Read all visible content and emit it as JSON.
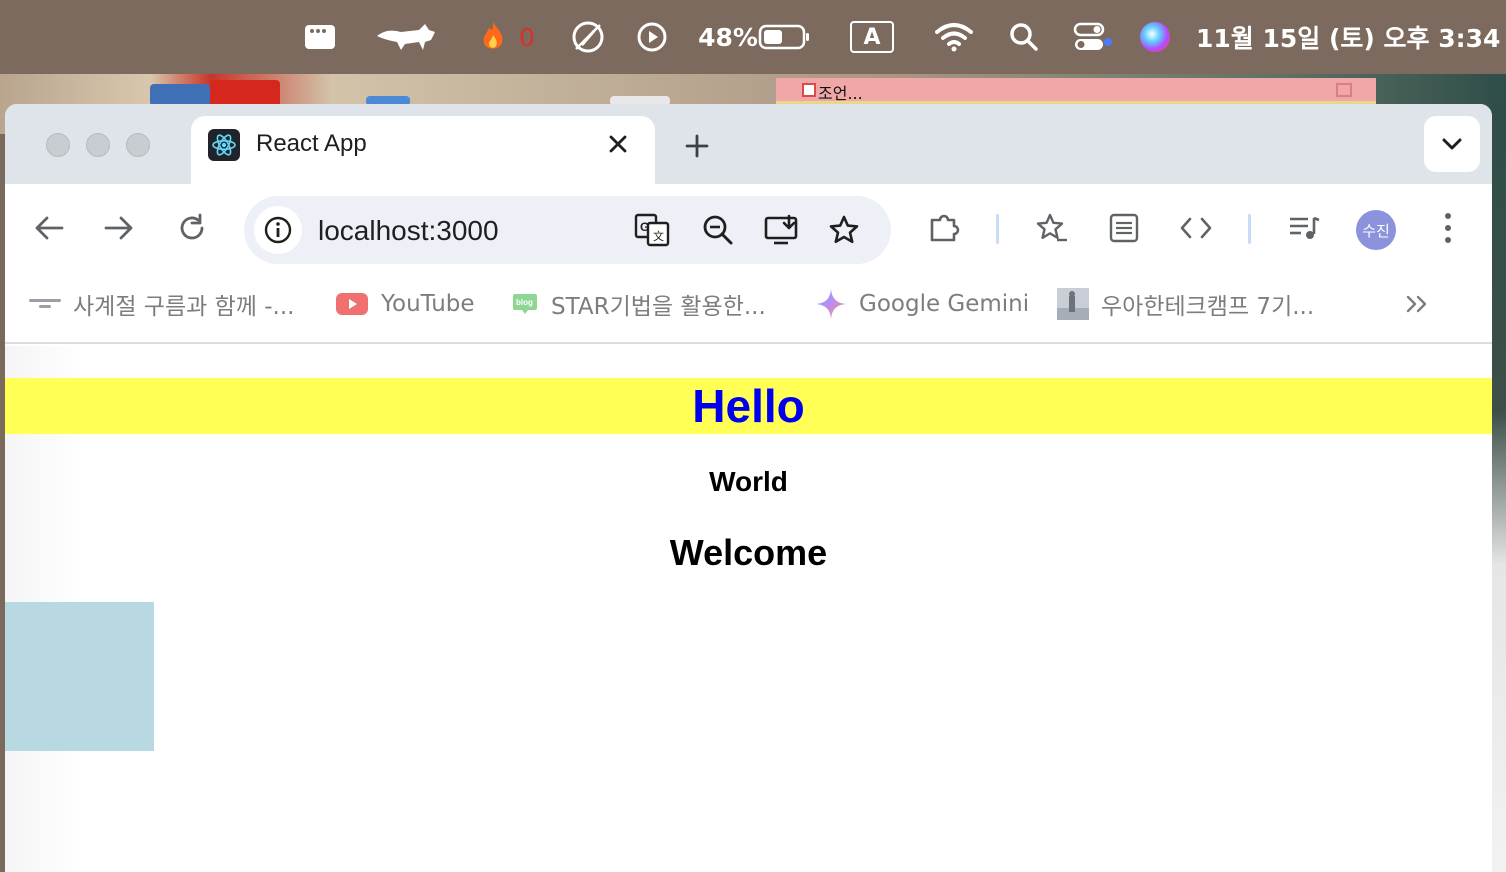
{
  "menubar": {
    "fire_count": "0",
    "battery_percent": "48%",
    "input_method": "A",
    "datetime": "11월 15일 (토) 오후 3:34"
  },
  "sticky_note": {
    "title": "조언..."
  },
  "browser": {
    "tab_title": "React App",
    "url": "localhost:3000",
    "profile_initials": "수진"
  },
  "bookmarks": [
    {
      "label": "사계절 구름과 함께 -...",
      "icon": "goormthon-icon"
    },
    {
      "label": "YouTube",
      "icon": "youtube-icon"
    },
    {
      "label": "STAR기법을 활용한...",
      "icon": "blog-icon"
    },
    {
      "label": "Google Gemini",
      "icon": "gemini-icon"
    },
    {
      "label": "우아한테크캠프 7기...",
      "icon": "thumbnail-icon"
    }
  ],
  "page": {
    "heading1": "Hello",
    "heading2": "World",
    "heading3": "Welcome"
  },
  "colors": {
    "banner_bg": "#ffff55",
    "hello_color": "#0000ee",
    "box_color": "#b8d8e2"
  }
}
